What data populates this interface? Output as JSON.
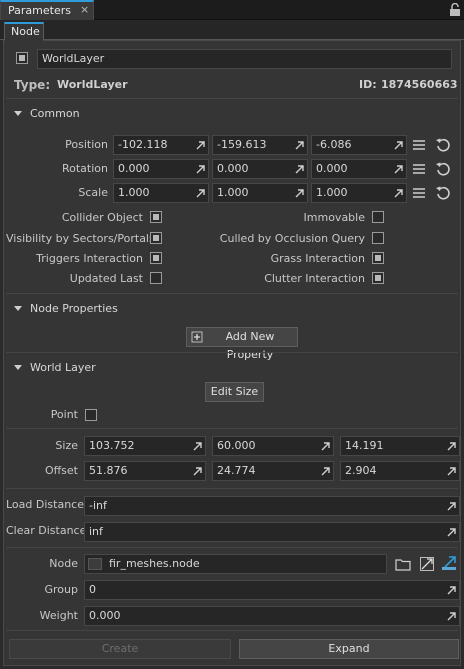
{
  "window": {
    "title": "Parameters",
    "close_glyph": "×",
    "lock_icon": "lock-icon"
  },
  "tabs": [
    {
      "label": "Node"
    }
  ],
  "node": {
    "name_value": "WorldLayer",
    "enabled_checked": true,
    "type_label": "Type:",
    "type_value": "WorldLayer",
    "id_label": "ID:",
    "id_value": "1874560663"
  },
  "common": {
    "header": "Common",
    "position": {
      "label": "Position",
      "values": [
        "-102.118",
        "-159.613",
        "-6.086"
      ]
    },
    "rotation": {
      "label": "Rotation",
      "values": [
        "0.000",
        "0.000",
        "0.000"
      ]
    },
    "scale": {
      "label": "Scale",
      "values": [
        "1.000",
        "1.000",
        "1.000"
      ]
    },
    "flags_left": [
      {
        "label": "Collider Object",
        "checked": true
      },
      {
        "label": "Visibility by Sectors/Portals",
        "checked": true
      },
      {
        "label": "Triggers Interaction",
        "checked": true
      },
      {
        "label": "Updated Last",
        "checked": false
      }
    ],
    "flags_right": [
      {
        "label": "Immovable",
        "checked": false
      },
      {
        "label": "Culled by Occlusion Query",
        "checked": false
      },
      {
        "label": "Grass Interaction",
        "checked": true
      },
      {
        "label": "Clutter Interaction",
        "checked": true
      }
    ]
  },
  "node_properties": {
    "header": "Node Properties",
    "add_button": "Add New Property"
  },
  "world_layer": {
    "header": "World Layer",
    "edit_size_button": "Edit Size",
    "point_label": "Point",
    "point_checked": false,
    "size": {
      "label": "Size",
      "values": [
        "103.752",
        "60.000",
        "14.191"
      ]
    },
    "offset": {
      "label": "Offset",
      "values": [
        "51.876",
        "24.774",
        "2.904"
      ]
    },
    "load_distance": {
      "label": "Load Distance",
      "value": "-inf"
    },
    "clear_distance": {
      "label": "Clear Distance",
      "value": "inf"
    },
    "node_file": {
      "label": "Node",
      "value": "fir_meshes.node"
    },
    "group": {
      "label": "Group",
      "value": "0"
    },
    "weight": {
      "label": "Weight",
      "value": "0.000"
    }
  },
  "footer": {
    "create_button": "Create",
    "expand_button": "Expand"
  }
}
